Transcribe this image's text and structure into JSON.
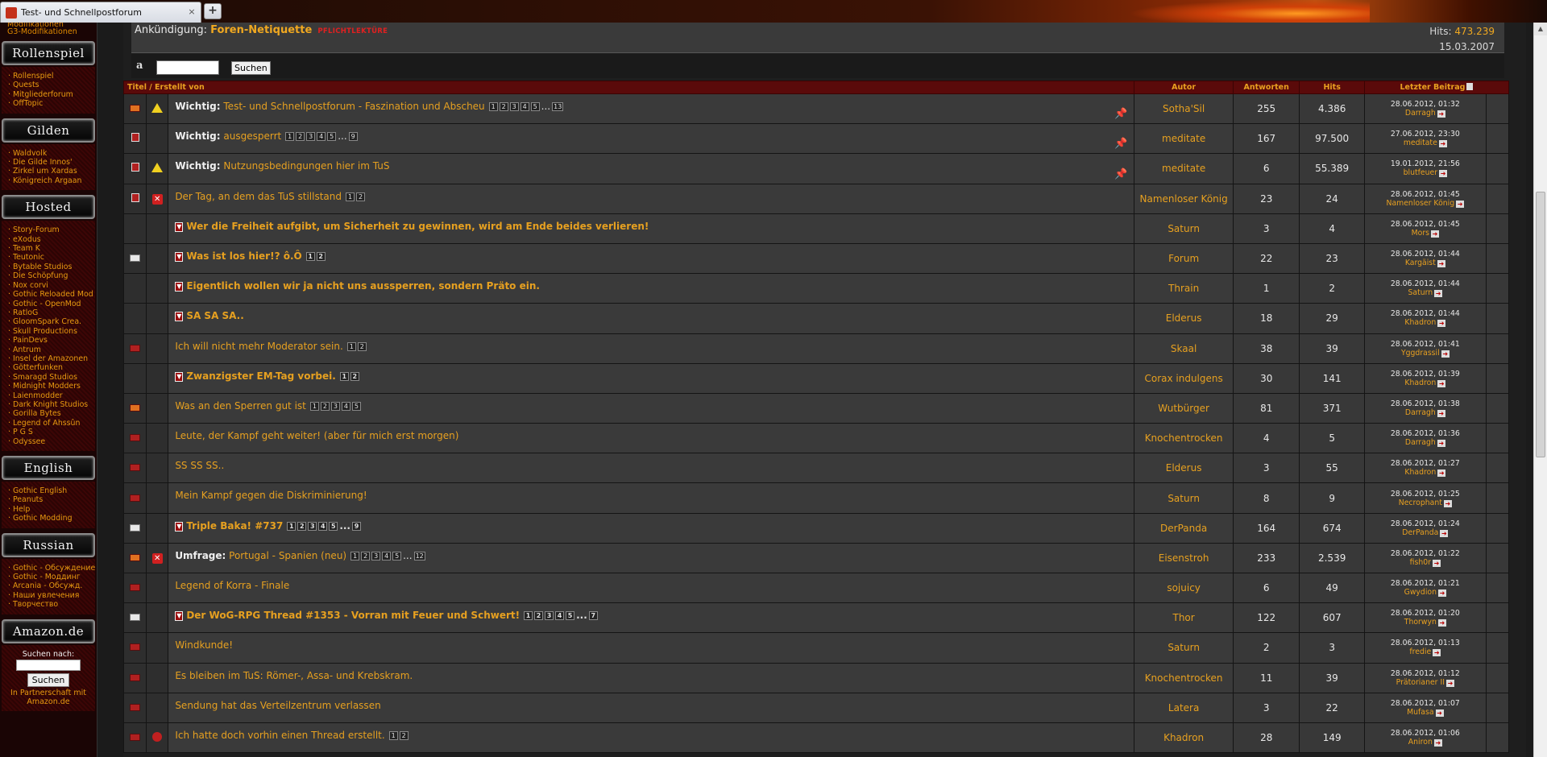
{
  "browser": {
    "tab_title": "Test- und Schnellpostforum",
    "tab_close": "×",
    "new_tab": "+"
  },
  "sidebar": {
    "top_items": [
      "Modifikationen",
      "G3-Modifikationen"
    ],
    "sections": [
      {
        "title": "Rollenspiel",
        "items": [
          "Rollenspiel",
          "Quests",
          "Mitgliederforum",
          "OffTopic"
        ]
      },
      {
        "title": "Gilden",
        "items": [
          "Waldvolk",
          "Die Gilde Innos'",
          "Zirkel um Xardas",
          "Königreich Argaan"
        ]
      },
      {
        "title": "Hosted",
        "items": [
          "Story-Forum",
          "eXodus",
          "Team K",
          "Teutonic",
          "Bytable Studios",
          "Die Schöpfung",
          "Nox corvi",
          "Gothic Reloaded Mod",
          "Gothic - OpenMod",
          "RatloG",
          "GloomSpark Crea.",
          "Skull Productions",
          "PainDevs",
          "Antrum",
          "Insel der Amazonen",
          "Götterfunken",
          "Smaragd Studios",
          "Midnight Modders",
          "Laienmodder",
          "Dark Knight Studios",
          "Gorilla Bytes",
          "Legend of Ahssûn",
          "P G S",
          "Odyssee"
        ]
      },
      {
        "title": "English",
        "items": [
          "Gothic English",
          "Peanuts",
          "Help",
          "Gothic Modding"
        ]
      },
      {
        "title": "Russian",
        "items": [
          "Gothic - Обсуждение",
          "Gothic - Моддинг",
          "Arcania - Обсужд.",
          "Наши увлечения",
          "Творчество"
        ]
      }
    ],
    "amazon": {
      "title": "Amazon.de",
      "search_label": "Suchen nach:",
      "button": "Suchen",
      "partner": "In Partnerschaft mit Amazon.de"
    }
  },
  "announcement": {
    "label": "Ankündigung:",
    "title": "Foren-Netiquette",
    "tag": "PFLICHTLEKTÜRE",
    "hits_label": "Hits:",
    "hits": "473.239",
    "date": "15.03.2007"
  },
  "search": {
    "amazon_glyph": "a",
    "button": "Suchen"
  },
  "table": {
    "headers": {
      "title": "Titel / Erstellt von",
      "author": "Autor",
      "replies": "Antworten",
      "hits": "Hits",
      "last": "Letzter Beitrag"
    },
    "rows": [
      {
        "icon": "new",
        "flag": "warn",
        "prefix": "Wichtig:",
        "title": "Test- und Schnellpostforum - Faszination und Abscheu",
        "pages": [
          "1",
          "2",
          "3",
          "4",
          "5",
          "...",
          "13"
        ],
        "pinned": true,
        "author": "Sotha'Sil",
        "replies": "255",
        "hits": "4.386",
        "last_date": "28.06.2012, 01:32",
        "last_user": "Darragh"
      },
      {
        "icon": "lock",
        "flag": "",
        "prefix": "Wichtig:",
        "title": "ausgesperrt",
        "pages": [
          "1",
          "2",
          "3",
          "4",
          "5",
          "...",
          "9"
        ],
        "pinned": true,
        "author": "meditate",
        "replies": "167",
        "hits": "97.500",
        "last_date": "27.06.2012, 23:30",
        "last_user": "meditate"
      },
      {
        "icon": "lock",
        "flag": "warn",
        "prefix": "Wichtig:",
        "title": "Nutzungsbedingungen hier im TuS",
        "pages": [],
        "pinned": true,
        "author": "meditate",
        "replies": "6",
        "hits": "55.389",
        "last_date": "19.01.2012, 21:56",
        "last_user": "blutfeuer"
      },
      {
        "icon": "lock",
        "flag": "x",
        "title": "Der Tag, an dem das TuS stillstand",
        "pages": [
          "1",
          "2"
        ],
        "author": "Namenloser König",
        "replies": "23",
        "hits": "24",
        "last_date": "28.06.2012, 01:45",
        "last_user": "Namenloser König",
        "hot": true
      },
      {
        "icon": "",
        "flag": "",
        "arrow": true,
        "bold": true,
        "title": "Wer die Freiheit aufgibt, um Sicherheit zu gewinnen, wird am Ende beides verlieren!",
        "pages": [],
        "author": "Saturn",
        "replies": "3",
        "hits": "4",
        "last_date": "28.06.2012, 01:45",
        "last_user": "Mors",
        "hot": true
      },
      {
        "icon": "mail",
        "flag": "",
        "arrow": true,
        "bold": true,
        "title": "Was ist los hier!? ô.Ô",
        "pages": [
          "1",
          "2"
        ],
        "author": "Forum",
        "replies": "22",
        "hits": "23",
        "last_date": "28.06.2012, 01:44",
        "last_user": "Kargäist",
        "hot": true
      },
      {
        "icon": "",
        "flag": "",
        "arrow": true,
        "bold": true,
        "title": "Eigentlich wollen wir ja nicht uns aussperren, sondern Präto ein.",
        "pages": [],
        "author": "Thrain",
        "replies": "1",
        "hits": "2",
        "last_date": "28.06.2012, 01:44",
        "last_user": "Saturn",
        "hot": true
      },
      {
        "icon": "",
        "flag": "",
        "arrow": true,
        "bold": true,
        "title": "SA SA SA..",
        "pages": [],
        "author": "Elderus",
        "replies": "18",
        "hits": "29",
        "last_date": "28.06.2012, 01:44",
        "last_user": "Khadron",
        "hot": true
      },
      {
        "icon": "env",
        "flag": "",
        "title": "Ich will nicht mehr Moderator sein.",
        "pages": [
          "1",
          "2"
        ],
        "author": "Skaal",
        "replies": "38",
        "hits": "39",
        "last_date": "28.06.2012, 01:41",
        "last_user": "Yggdrassil",
        "hot": true
      },
      {
        "icon": "",
        "flag": "",
        "arrow": true,
        "bold": true,
        "title": "Zwanzigster EM-Tag vorbei.",
        "pages": [
          "1",
          "2"
        ],
        "author": "Corax indulgens",
        "replies": "30",
        "hits": "141",
        "last_date": "28.06.2012, 01:39",
        "last_user": "Khadron",
        "hot": true
      },
      {
        "icon": "new",
        "flag": "",
        "title": "Was an den Sperren gut ist",
        "pages": [
          "1",
          "2",
          "3",
          "4",
          "5"
        ],
        "author": "Wutbürger",
        "replies": "81",
        "hits": "371",
        "last_date": "28.06.2012, 01:38",
        "last_user": "Darragh",
        "hot": true
      },
      {
        "icon": "env",
        "flag": "",
        "title": "Leute, der Kampf geht weiter! (aber für mich erst morgen)",
        "pages": [],
        "author": "Knochentrocken",
        "replies": "4",
        "hits": "5",
        "last_date": "28.06.2012, 01:36",
        "last_user": "Darragh",
        "hot": true
      },
      {
        "icon": "env",
        "flag": "",
        "title": "SS SS SS..",
        "pages": [],
        "author": "Elderus",
        "replies": "3",
        "hits": "55",
        "last_date": "28.06.2012, 01:27",
        "last_user": "Khadron",
        "hot": true
      },
      {
        "icon": "env",
        "flag": "",
        "title": "Mein Kampf gegen die Diskriminierung!",
        "pages": [],
        "author": "Saturn",
        "replies": "8",
        "hits": "9",
        "last_date": "28.06.2012, 01:25",
        "last_user": "Necrophant",
        "hot": true
      },
      {
        "icon": "mail",
        "flag": "",
        "arrow": true,
        "bold": true,
        "title": "Triple Baka! #737",
        "pages": [
          "1",
          "2",
          "3",
          "4",
          "5",
          "...",
          "9"
        ],
        "author": "DerPanda",
        "replies": "164",
        "hits": "674",
        "last_date": "28.06.2012, 01:24",
        "last_user": "DerPanda",
        "hot": true
      },
      {
        "icon": "new",
        "flag": "x",
        "prefix": "Umfrage:",
        "title": "Portugal - Spanien (neu)",
        "pages": [
          "1",
          "2",
          "3",
          "4",
          "5",
          "...",
          "12"
        ],
        "author": "Eisenstroh",
        "replies": "233",
        "hits": "2.539",
        "last_date": "28.06.2012, 01:22",
        "last_user": "fish0r",
        "hot": true
      },
      {
        "icon": "env",
        "flag": "",
        "title": "Legend of Korra - Finale",
        "pages": [],
        "author": "sojuicy",
        "replies": "6",
        "hits": "49",
        "last_date": "28.06.2012, 01:21",
        "last_user": "Gwydion",
        "hot": true
      },
      {
        "icon": "mail",
        "flag": "",
        "arrow": true,
        "bold": true,
        "title": "Der WoG-RPG Thread #1353 - Vorran mit Feuer und Schwert!",
        "pages": [
          "1",
          "2",
          "3",
          "4",
          "5",
          "...",
          "7"
        ],
        "author": "Thor",
        "replies": "122",
        "hits": "607",
        "last_date": "28.06.2012, 01:20",
        "last_user": "Thorwyn",
        "hot": true
      },
      {
        "icon": "env",
        "flag": "",
        "title": "Windkunde!",
        "pages": [],
        "author": "Saturn",
        "replies": "2",
        "hits": "3",
        "last_date": "28.06.2012, 01:13",
        "last_user": "fredie",
        "hot": true
      },
      {
        "icon": "env",
        "flag": "",
        "title": "Es bleiben im TuS: Römer-, Assa- und Krebskram.",
        "pages": [],
        "author": "Knochentrocken",
        "replies": "11",
        "hits": "39",
        "last_date": "28.06.2012, 01:12",
        "last_user": "Prätorianer II",
        "hot": true
      },
      {
        "icon": "env",
        "flag": "",
        "title": "Sendung hat das Verteilzentrum verlassen",
        "pages": [],
        "author": "Latera",
        "replies": "3",
        "hits": "22",
        "last_date": "28.06.2012, 01:07",
        "last_user": "Mufasa",
        "hot": true
      },
      {
        "icon": "env",
        "flag": "ball",
        "title": "Ich hatte doch vorhin einen Thread erstellt.",
        "pages": [
          "1",
          "2"
        ],
        "author": "Khadron",
        "replies": "28",
        "hits": "149",
        "last_date": "28.06.2012, 01:06",
        "last_user": "Aniron",
        "hot": true
      }
    ]
  }
}
